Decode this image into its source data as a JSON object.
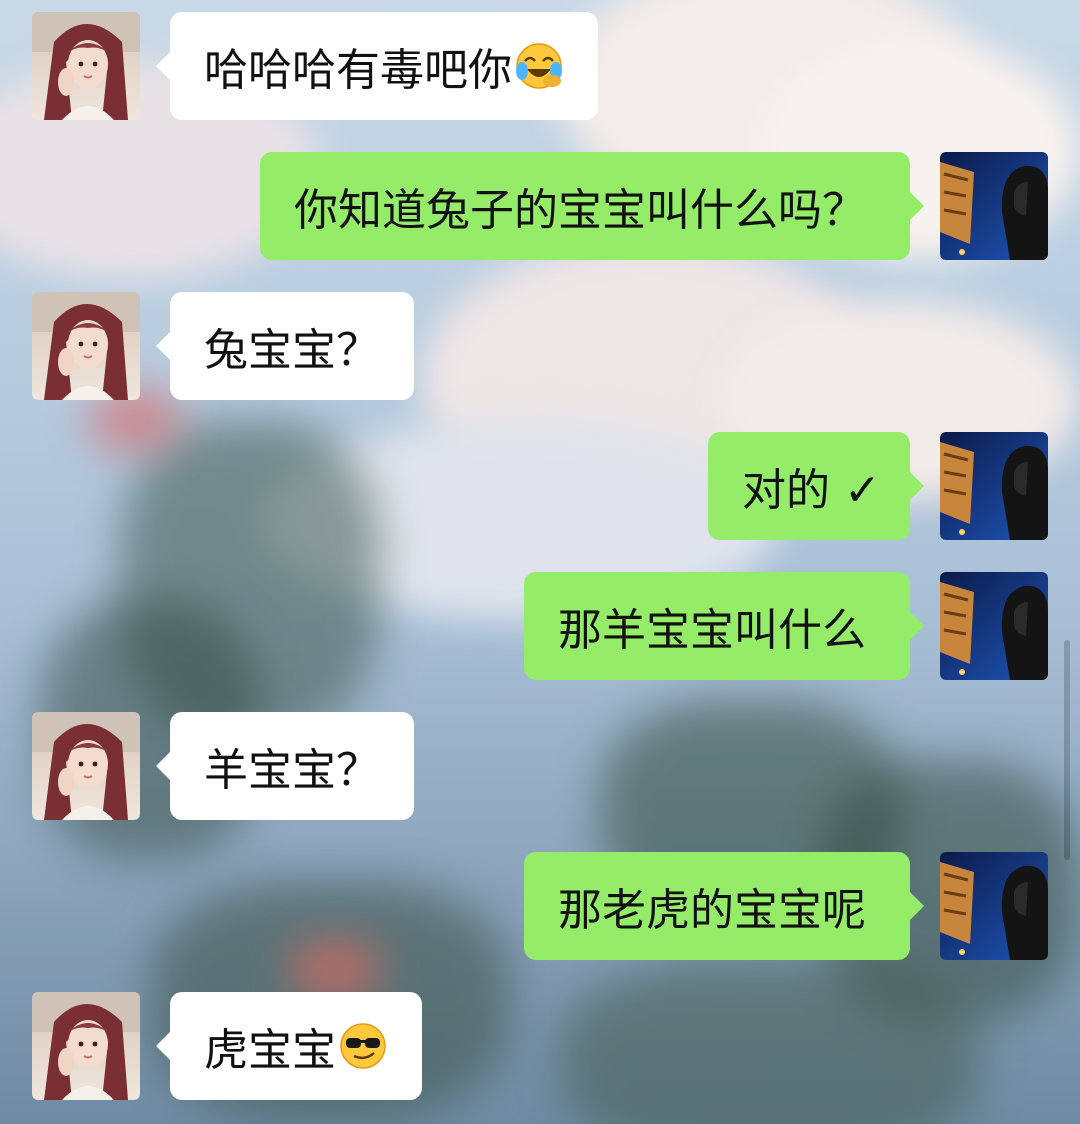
{
  "colors": {
    "incoming_bubble": "#ffffff",
    "outgoing_bubble": "#95ec69",
    "text": "#111111"
  },
  "messages": [
    {
      "side": "in",
      "text": "哈哈哈有毒吧你",
      "emoji": "laughing-crying-emoji"
    },
    {
      "side": "out",
      "text": "你知道兔子的宝宝叫什么吗？"
    },
    {
      "side": "in",
      "text": "兔宝宝？"
    },
    {
      "side": "out",
      "text": "对的 ✓"
    },
    {
      "side": "out",
      "text": "那羊宝宝叫什么"
    },
    {
      "side": "in",
      "text": "羊宝宝？"
    },
    {
      "side": "out",
      "text": "那老虎的宝宝呢"
    },
    {
      "side": "in",
      "text": "虎宝宝",
      "emoji": "sunglasses-emoji"
    }
  ]
}
